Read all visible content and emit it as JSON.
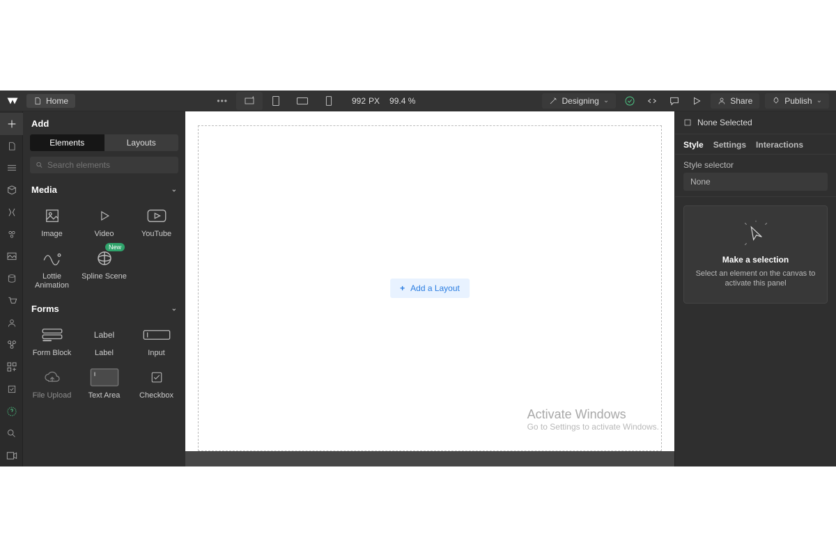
{
  "top": {
    "home_label": "Home",
    "designing_label": "Designing",
    "share_label": "Share",
    "publish_label": "Publish",
    "width": "992",
    "px": "PX",
    "zoom": "99.4 %"
  },
  "panel": {
    "title": "Add",
    "tab_elements": "Elements",
    "tab_layouts": "Layouts",
    "search_placeholder": "Search elements",
    "section_media": "Media",
    "section_forms": "Forms",
    "items": {
      "image": "Image",
      "video": "Video",
      "youtube": "YouTube",
      "lottie": "Lottie Animation",
      "spline": "Spline Scene",
      "formblock": "Form Block",
      "label": "Label",
      "input": "Input",
      "fileupload": "File Upload",
      "textarea": "Text Area",
      "checkbox": "Checkbox"
    },
    "badge_new": "New"
  },
  "canvas": {
    "add_layout": "Add a Layout"
  },
  "right": {
    "none_selected": "None Selected",
    "tab_style": "Style",
    "tab_settings": "Settings",
    "tab_interactions": "Interactions",
    "style_selector": "Style selector",
    "selector_value": "None",
    "make_selection": "Make a selection",
    "make_selection_sub": "Select an element on the canvas to activate this panel"
  },
  "watermark": {
    "title": "Activate Windows",
    "sub": "Go to Settings to activate Windows."
  }
}
